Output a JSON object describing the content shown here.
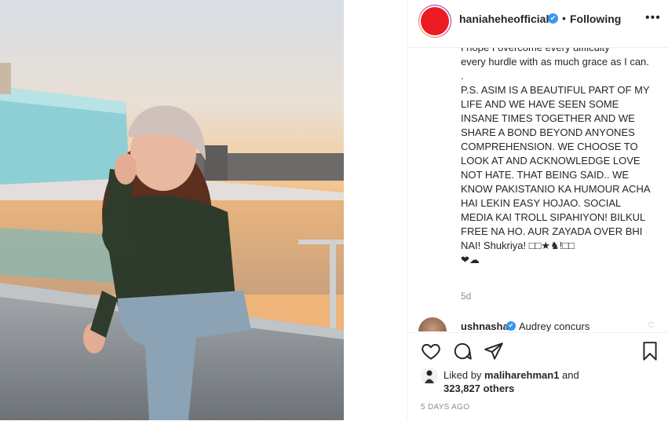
{
  "post": {
    "username": "haniaheheofficial",
    "verified_mark": "✔",
    "separator": "•",
    "follow_status": "Following",
    "more_icon": "more-options-icon",
    "photo_alt": "Woman in a beanie and green sweater sitting on a ledge at sunset by the water"
  },
  "caption": {
    "line_top": "I hope I overcome every difficulty",
    "line_1": "every hurdle with as much grace as I can.",
    "dot": ".",
    "body": "P.S. ASIM IS A BEAUTIFUL PART OF MY LIFE AND WE HAVE SEEN SOME INSANE TIMES TOGETHER AND WE SHARE A BOND BEYOND ANYONES COMPREHENSION. WE CHOOSE TO LOOK AT AND ACKNOWLEDGE LOVE NOT HATE. THAT BEING SAID.. WE KNOW PAKISTANIO KA HUMOUR ACHA HAI LEKIN EASY HOJAO. SOCIAL MEDIA KAI TROLL SIPAHIYON! BILKUL FREE NA HO. AUR ZAYADA OVER BHI NAI! Shukriya! □□★♞!□□",
    "emoji_tail": "❤︎☁"
  },
  "age": "5d",
  "comment": {
    "username": "ushnashah",
    "verified_mark": "✔",
    "text": "Audrey concurs"
  },
  "actions": {
    "like_icon": "heart-icon",
    "comment_icon": "comment-icon",
    "share_icon": "share-icon",
    "save_icon": "bookmark-icon"
  },
  "likes": {
    "prefix": "Liked by ",
    "user": "maliharehman1",
    "middle": " and",
    "count": "323,827 others"
  },
  "timestamp": "5 DAYS AGO"
}
